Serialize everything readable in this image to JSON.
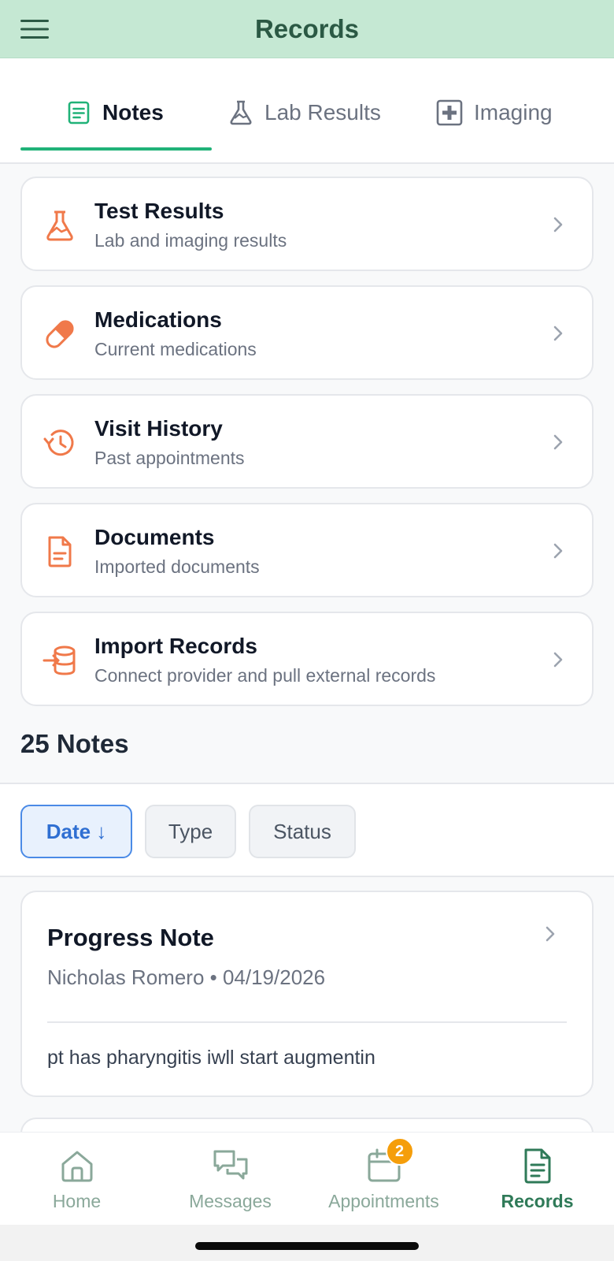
{
  "header": {
    "title": "Records"
  },
  "tabs": [
    {
      "label": "Notes",
      "icon": "note-icon",
      "active": true
    },
    {
      "label": "Lab Results",
      "icon": "flask-icon",
      "active": false
    },
    {
      "label": "Imaging",
      "icon": "medical-cross-icon",
      "active": false
    }
  ],
  "categories": [
    {
      "title": "Test Results",
      "subtitle": "Lab and imaging results",
      "icon": "flask-icon"
    },
    {
      "title": "Medications",
      "subtitle": "Current medications",
      "icon": "pill-icon"
    },
    {
      "title": "Visit History",
      "subtitle": "Past appointments",
      "icon": "history-icon"
    },
    {
      "title": "Documents",
      "subtitle": "Imported documents",
      "icon": "document-icon"
    },
    {
      "title": "Import Records",
      "subtitle": "Connect provider and pull external records",
      "icon": "database-import-icon"
    }
  ],
  "notes_count": "25 Notes",
  "filters": [
    {
      "label": "Date ↓",
      "active": true
    },
    {
      "label": "Type",
      "active": false
    },
    {
      "label": "Status",
      "active": false
    }
  ],
  "note": {
    "title": "Progress Note",
    "meta": "Nicholas Romero • 04/19/2026",
    "body": "pt has pharyngitis iwll start augmentin"
  },
  "bottom_nav": [
    {
      "label": "Home",
      "icon": "home-icon",
      "active": false
    },
    {
      "label": "Messages",
      "icon": "messages-icon",
      "active": false
    },
    {
      "label": "Appointments",
      "icon": "calendar-icon",
      "active": false,
      "badge": "2"
    },
    {
      "label": "Records",
      "icon": "records-icon",
      "active": true
    }
  ],
  "colors": {
    "header_bg": "#c5e8d3",
    "accent_green": "#20b278",
    "icon_orange": "#f0794a",
    "chip_active_blue": "#2f6fd2",
    "badge_orange": "#f59e0b"
  }
}
